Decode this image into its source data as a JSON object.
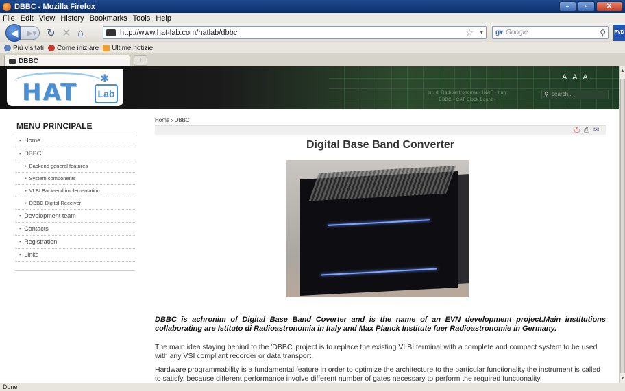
{
  "window": {
    "title": "DBBC - Mozilla Firefox"
  },
  "menu": [
    "File",
    "Edit",
    "View",
    "History",
    "Bookmarks",
    "Tools",
    "Help"
  ],
  "nav": {
    "url": "http://www.hat-lab.com/hatlab/dbbc",
    "search_engine": "Google",
    "search_placeholder": "Google",
    "addon_label": "PVD"
  },
  "bookmarks": [
    {
      "label": "Più visitati",
      "color": "#5a7fc2"
    },
    {
      "label": "Come iniziare",
      "color": "#c0392b"
    },
    {
      "label": "Ultime notizie",
      "color": "#f0a030"
    }
  ],
  "tab": {
    "label": "DBBC"
  },
  "header": {
    "logo_text": "HAT",
    "logo_sub": "Lab",
    "tagline_1": "Ist. di Radioastronomia - INAF - Italy",
    "tagline_2": "DBBC - CAT Clock Board -",
    "font_sizes": "A A A",
    "search_placeholder": "search..."
  },
  "sidebar": {
    "title": "MENU PRINCIPALE",
    "items": [
      {
        "label": "Home",
        "sub": false
      },
      {
        "label": "DBBC",
        "sub": false
      },
      {
        "label": "Backend general features",
        "sub": true
      },
      {
        "label": "System components",
        "sub": true
      },
      {
        "label": "VLBI Back-end implementation",
        "sub": true
      },
      {
        "label": "DBBC Digital Receiver",
        "sub": true
      },
      {
        "label": "Development team",
        "sub": false
      },
      {
        "label": "Contacts",
        "sub": false
      },
      {
        "label": "Registration",
        "sub": false
      },
      {
        "label": "Links",
        "sub": false
      }
    ]
  },
  "content": {
    "breadcrumb": "Home  ›  DBBC",
    "title": "Digital Base Band Converter",
    "intro": "DBBC is achronim of Digital Base Band Coverter and is the name of an EVN development project.Main institutions collaborating are Istituto di Radioastronomia in Italy and Max Planck Institute fuer Radioastronomie in Germany.",
    "para2": "The main idea staying behind to the 'DBBC' project is to replace the existing VLBI terminal with a complete and compact system to be used with any VSI compliant recorder or data transport.",
    "para3": "Hardware programmability is a fundamental feature in order to optimize the architecture to the particular functionality the instrument is called to satisfy, because different performance involve different number of gates necessary to perform the required functionality."
  },
  "status": {
    "text": "Done"
  }
}
